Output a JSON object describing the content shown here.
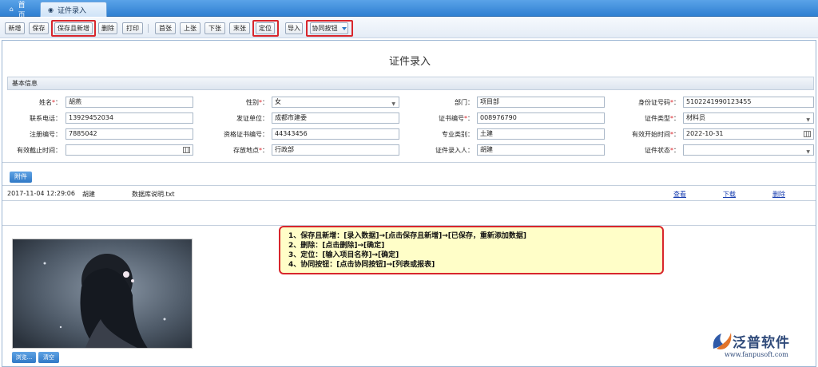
{
  "tabs": {
    "home": "首页",
    "active": "证件录入"
  },
  "toolbar": {
    "add": "新增",
    "save": "保存",
    "save_add": "保存且新增",
    "delete": "删除",
    "print": "打印",
    "first": "首张",
    "prev": "上张",
    "next": "下张",
    "last": "末张",
    "locate": "定位",
    "import": "导入",
    "collab": "协同按钮"
  },
  "page_title": "证件录入",
  "basic_section": "基本信息",
  "form": {
    "name_label": "姓名",
    "name": "胡燕",
    "gender_label": "性别",
    "gender": "女",
    "dept_label": "部门",
    "dept": "项目部",
    "id_label": "身份证号码",
    "id": "5102241990123455",
    "phone_label": "联系电话",
    "phone": "13929452034",
    "issuer_label": "发证单位",
    "issuer": "成都市建委",
    "cert_no_label": "证书编号",
    "cert_no": "008976790",
    "cert_type_label": "证件类型",
    "cert_type": "材料员",
    "reg_no_label": "注册编号",
    "reg_no": "7885042",
    "qual_no_label": "资格证书编号",
    "qual_no": "44343456",
    "major_label": "专业类别",
    "major": "土建",
    "start_label": "有效开始时间",
    "start": "2022-10-31",
    "end_label": "有效截止时间",
    "end": "",
    "place_label": "存放地点",
    "place": "行政部",
    "entry_label": "证件录入人",
    "entry": "胡建",
    "status_label": "证件状态",
    "status": ""
  },
  "attachment": {
    "button": "附件",
    "row": {
      "time": "2017-11-04 12:29:06",
      "user": "胡建",
      "file": "数据库说明.txt",
      "view": "查看",
      "download": "下载",
      "delete": "删除"
    }
  },
  "note": {
    "line1": "1、保存且新增：[录入数据]→[点击保存且新增]→[已保存，重新添加数据]",
    "line2": "2、删除：[点击删除]→[确定]",
    "line3": "3、定位：[输入项目名称]→[确定]",
    "line4": "4、协同按钮：[点击协同按钮]→[列表或报表]"
  },
  "photo": {
    "browse": "浏览...",
    "clear": "清空"
  },
  "logo": {
    "name": "泛普软件",
    "url": "www.fanpusoft.com"
  }
}
